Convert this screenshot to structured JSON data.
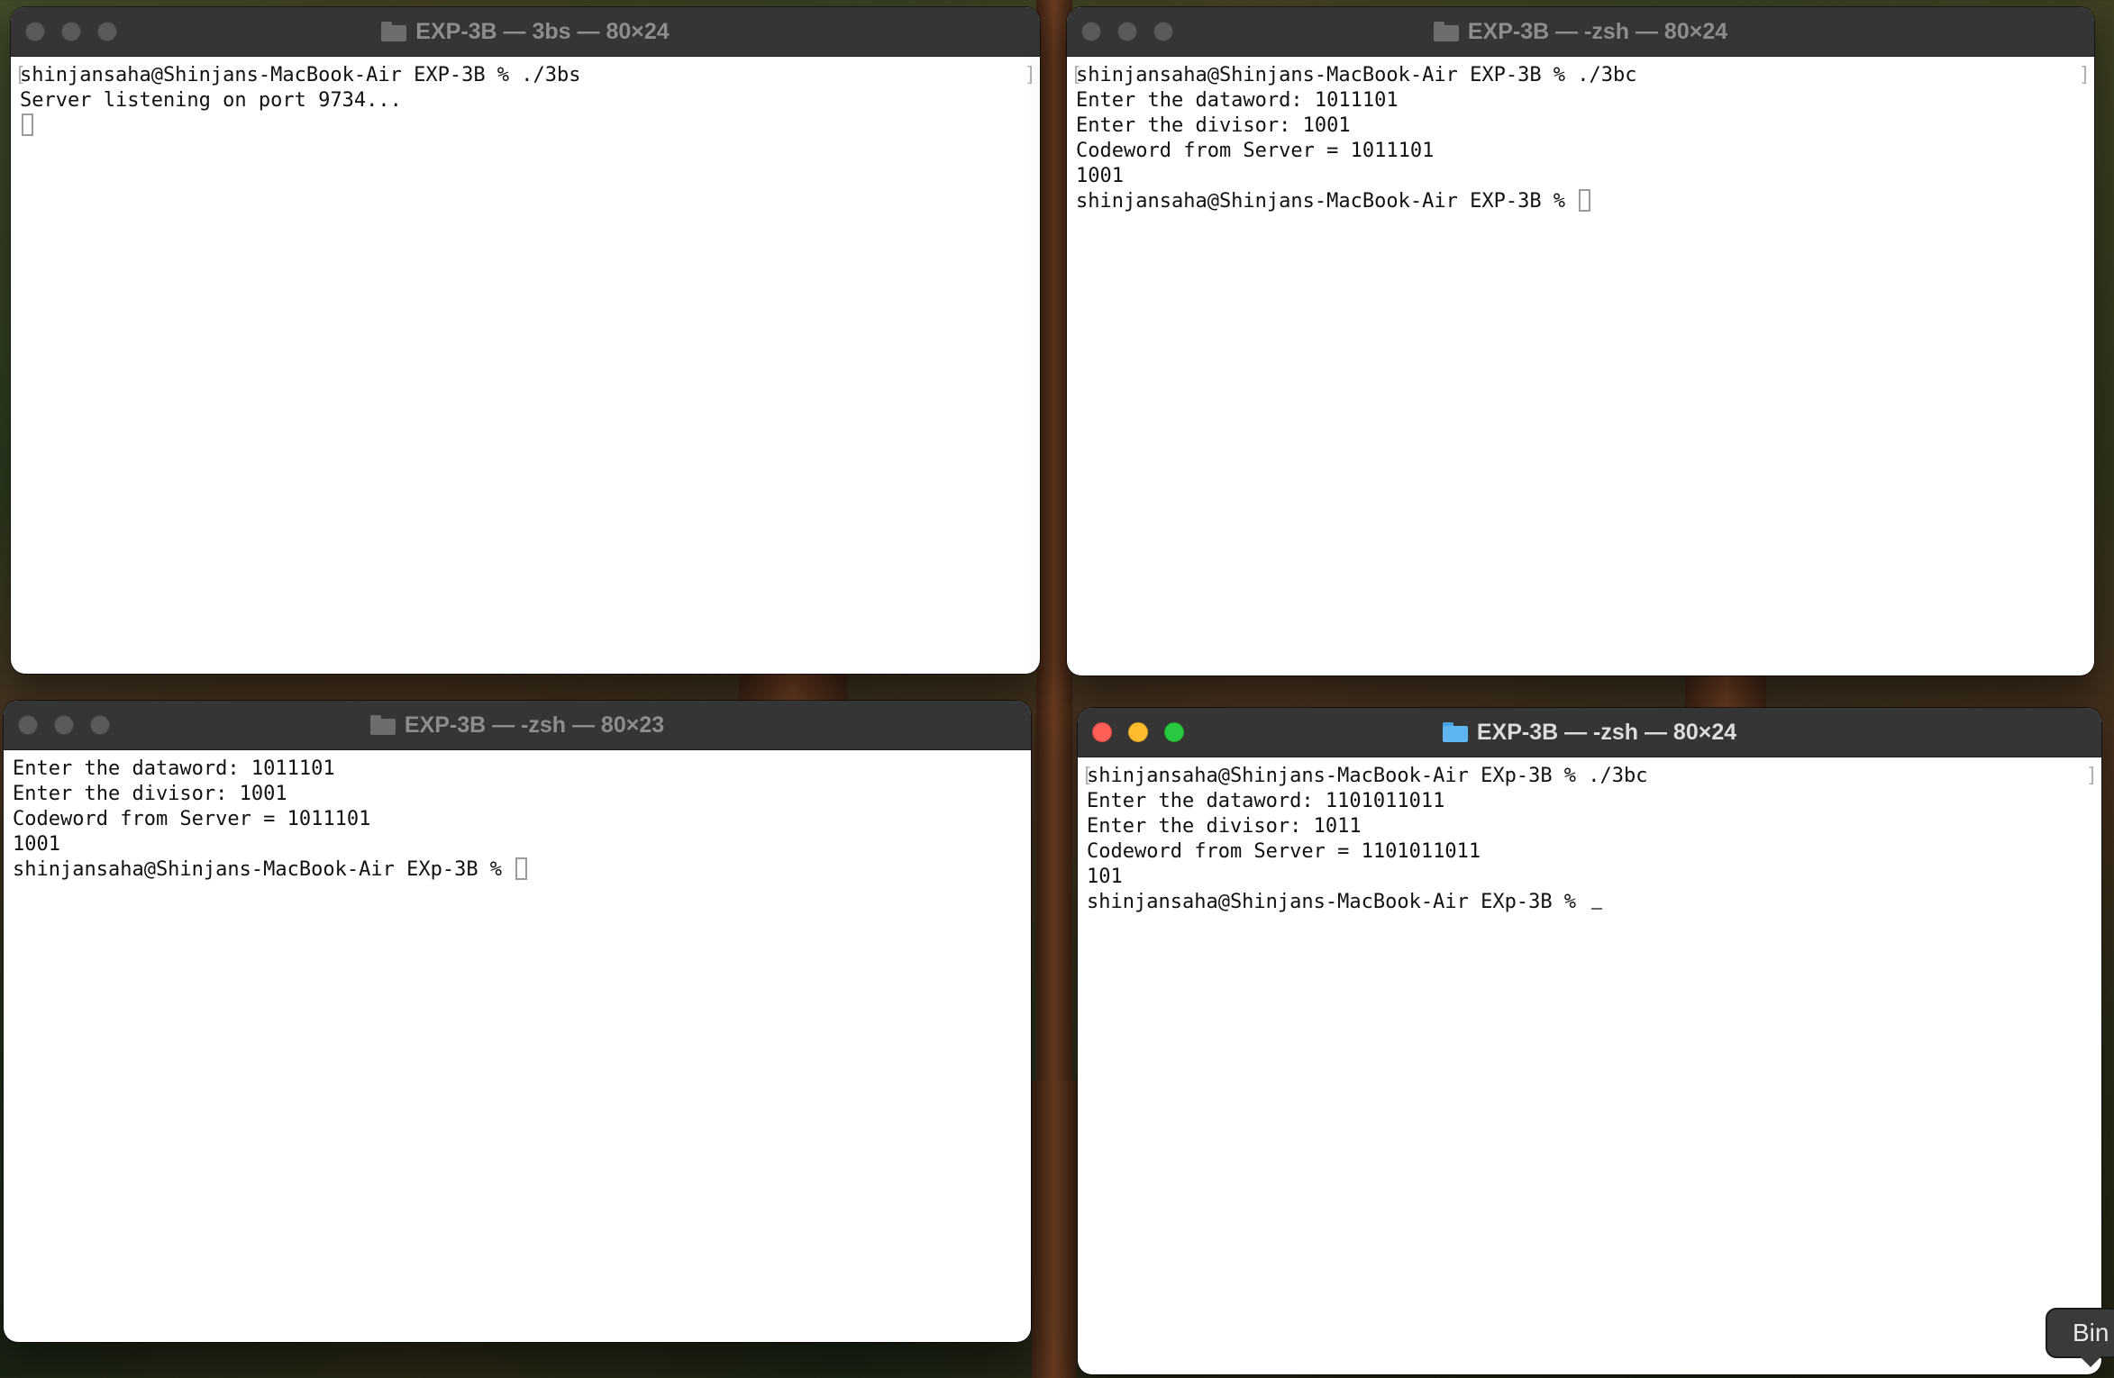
{
  "windows": [
    {
      "title": "EXP-3B — 3bs — 80×24",
      "lines": [
        "shinjansaha@Shinjans-MacBook-Air EXP-3B % ./3bs",
        "Server listening on port 9734..."
      ]
    },
    {
      "title": "EXP-3B — -zsh — 80×24",
      "lines": [
        "shinjansaha@Shinjans-MacBook-Air EXP-3B % ./3bc",
        "Enter the dataword: 1011101",
        "Enter the divisor: 1001",
        "Codeword from Server = 1011101",
        "1001",
        "shinjansaha@Shinjans-MacBook-Air EXP-3B % "
      ]
    },
    {
      "title": "EXP-3B — -zsh — 80×23",
      "lines": [
        "Enter the dataword: 1011101",
        "Enter the divisor: 1001",
        "Codeword from Server = 1011101",
        "1001",
        "shinjansaha@Shinjans-MacBook-Air EXp-3B % "
      ]
    },
    {
      "title": "EXP-3B — -zsh — 80×24",
      "lines": [
        "shinjansaha@Shinjans-MacBook-Air EXp-3B % ./3bc",
        "Enter the dataword: 1101011011",
        "Enter the divisor: 1011",
        "Codeword from Server = 1101011011",
        "101",
        "shinjansaha@Shinjans-MacBook-Air EXp-3B % "
      ]
    }
  ],
  "tooltip": {
    "label": "Bin"
  },
  "colors": {
    "titlebar": "#353535",
    "close": "#ff5f57",
    "minimize": "#febc2e",
    "maximize": "#28c840",
    "folder_active": "#5eb5f2"
  },
  "icons": [
    "folder-icon",
    "close-icon",
    "minimize-icon",
    "maximize-icon"
  ]
}
